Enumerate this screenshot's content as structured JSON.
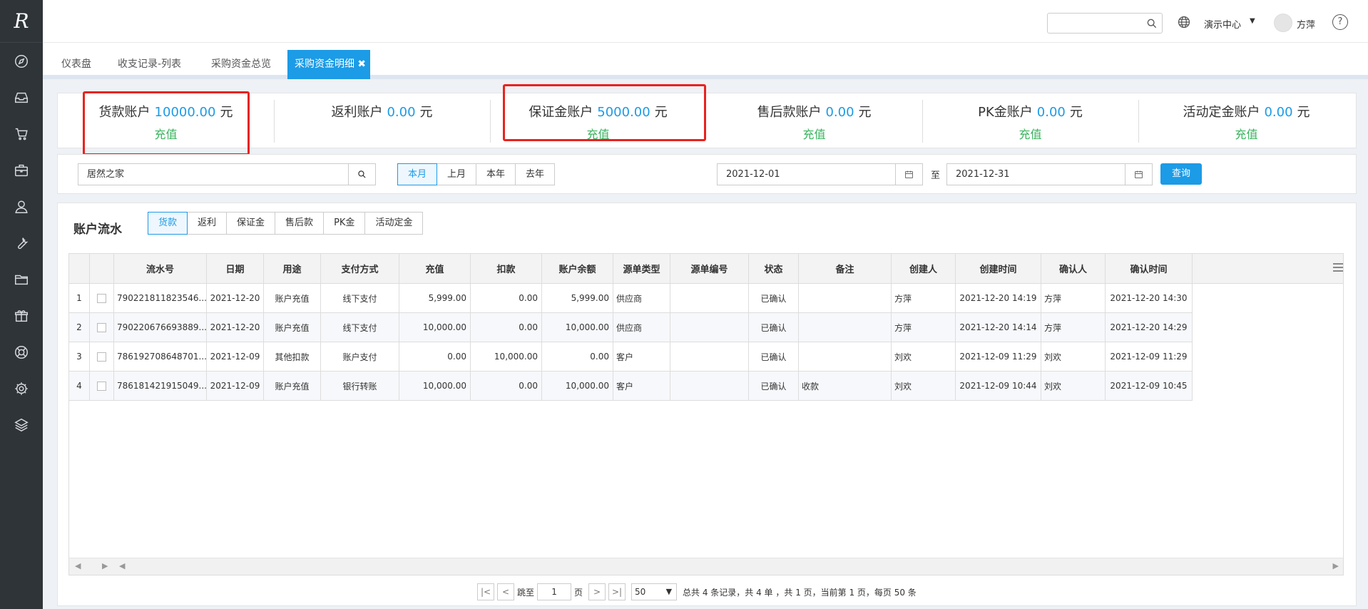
{
  "sidebar": {
    "logo": "R",
    "items": [
      "compass-icon",
      "inbox-icon",
      "cart-icon",
      "briefcase-icon",
      "user-icon",
      "wrench-icon",
      "folder-icon",
      "gift-icon",
      "lifebuoy-icon",
      "gear-icon",
      "layers-icon"
    ]
  },
  "topbar": {
    "search_placeholder": "",
    "center_label": "演示中心",
    "caret": "▼",
    "user_name": "方萍",
    "help": "?"
  },
  "tabs": [
    {
      "label": "仪表盘"
    },
    {
      "label": "收支记录-列表"
    },
    {
      "label": "采购资金总览"
    },
    {
      "label": "采购资金明细",
      "active": true,
      "close": "✖"
    }
  ],
  "accounts": [
    {
      "name": "货款账户",
      "value": "10000.00",
      "unit": "元",
      "action": "充值"
    },
    {
      "name": "返利账户",
      "value": "0.00",
      "unit": "元",
      "action": ""
    },
    {
      "name": "保证金账户",
      "value": "5000.00",
      "unit": "元",
      "action": "充值"
    },
    {
      "name": "售后款账户",
      "value": "0.00",
      "unit": "元",
      "action": "充值"
    },
    {
      "name": "PK金账户",
      "value": "0.00",
      "unit": "元",
      "action": "充值"
    },
    {
      "name": "活动定金账户",
      "value": "0.00",
      "unit": "元",
      "action": "充值"
    }
  ],
  "filter": {
    "company": "居然之家",
    "periods": [
      "本月",
      "上月",
      "本年",
      "去年"
    ],
    "selected_period": "本月",
    "date_from": "2021-12-01",
    "to_label": "至",
    "date_to": "2021-12-31",
    "query_label": "查询"
  },
  "ledger": {
    "title": "账户流水",
    "types": [
      "货款",
      "返利",
      "保证金",
      "售后款",
      "PK金",
      "活动定金"
    ],
    "selected_type": "货款",
    "columns": [
      "流水号",
      "日期",
      "用途",
      "支付方式",
      "充值",
      "扣款",
      "账户余额",
      "源单类型",
      "源单编号",
      "状态",
      "备注",
      "创建人",
      "创建时间",
      "确认人",
      "确认时间"
    ],
    "rows": [
      {
        "idx": "1",
        "serial": "790221811823546...",
        "date": "2021-12-20",
        "purpose": "账户充值",
        "pay": "线下支付",
        "recharge": "5,999.00",
        "deduct": "0.00",
        "balance": "5,999.00",
        "src_type": "供应商",
        "src_no": "",
        "status": "已确认",
        "remark": "",
        "creator": "方萍",
        "created": "2021-12-20 14:19",
        "confirmer": "方萍",
        "confirmed": "2021-12-20 14:30"
      },
      {
        "idx": "2",
        "serial": "790220676693889...",
        "date": "2021-12-20",
        "purpose": "账户充值",
        "pay": "线下支付",
        "recharge": "10,000.00",
        "deduct": "0.00",
        "balance": "10,000.00",
        "src_type": "供应商",
        "src_no": "",
        "status": "已确认",
        "remark": "",
        "creator": "方萍",
        "created": "2021-12-20 14:14",
        "confirmer": "方萍",
        "confirmed": "2021-12-20 14:29"
      },
      {
        "idx": "3",
        "serial": "786192708648701...",
        "date": "2021-12-09",
        "purpose": "其他扣款",
        "pay": "账户支付",
        "recharge": "0.00",
        "deduct": "10,000.00",
        "balance": "0.00",
        "src_type": "客户",
        "src_no": "",
        "status": "已确认",
        "remark": "",
        "creator": "刘欢",
        "created": "2021-12-09 11:29",
        "confirmer": "刘欢",
        "confirmed": "2021-12-09 11:29"
      },
      {
        "idx": "4",
        "serial": "786181421915049...",
        "date": "2021-12-09",
        "purpose": "账户充值",
        "pay": "银行转账",
        "recharge": "10,000.00",
        "deduct": "0.00",
        "balance": "10,000.00",
        "src_type": "客户",
        "src_no": "",
        "status": "已确认",
        "remark": "收款",
        "creator": "刘欢",
        "created": "2021-12-09 10:44",
        "confirmer": "刘欢",
        "confirmed": "2021-12-09 10:45"
      }
    ]
  },
  "pager": {
    "goto_label": "跳至",
    "page_value": "1",
    "page_unit": "页",
    "page_size": "50",
    "summary": "总共 4 条记录，共 4 单 ，共 1 页，当前第 1 页，每页 50 条"
  },
  "colors": {
    "accent": "#1c9be6",
    "recharge": "#37b35c",
    "highlight": "#e8231f",
    "sidebar": "#2f3439"
  }
}
